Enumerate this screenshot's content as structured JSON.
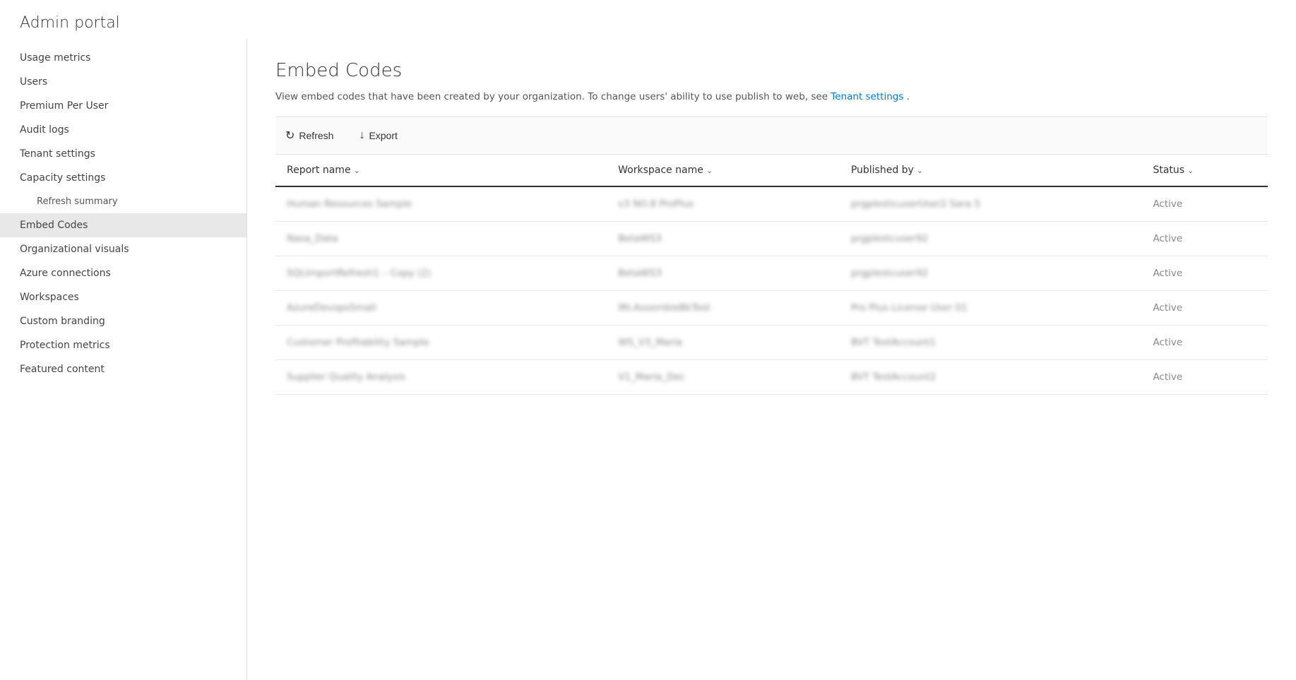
{
  "app": {
    "title": "Admin portal"
  },
  "sidebar": {
    "items": [
      {
        "id": "usage-metrics",
        "label": "Usage metrics",
        "indented": false,
        "active": false
      },
      {
        "id": "users",
        "label": "Users",
        "indented": false,
        "active": false
      },
      {
        "id": "premium-per-user",
        "label": "Premium Per User",
        "indented": false,
        "active": false
      },
      {
        "id": "audit-logs",
        "label": "Audit logs",
        "indented": false,
        "active": false
      },
      {
        "id": "tenant-settings",
        "label": "Tenant settings",
        "indented": false,
        "active": false
      },
      {
        "id": "capacity-settings",
        "label": "Capacity settings",
        "indented": false,
        "active": false
      },
      {
        "id": "refresh-summary",
        "label": "Refresh summary",
        "indented": true,
        "active": false
      },
      {
        "id": "embed-codes",
        "label": "Embed Codes",
        "indented": false,
        "active": true
      },
      {
        "id": "organizational-visuals",
        "label": "Organizational visuals",
        "indented": false,
        "active": false
      },
      {
        "id": "azure-connections",
        "label": "Azure connections",
        "indented": false,
        "active": false
      },
      {
        "id": "workspaces",
        "label": "Workspaces",
        "indented": false,
        "active": false
      },
      {
        "id": "custom-branding",
        "label": "Custom branding",
        "indented": false,
        "active": false
      },
      {
        "id": "protection-metrics",
        "label": "Protection metrics",
        "indented": false,
        "active": false
      },
      {
        "id": "featured-content",
        "label": "Featured content",
        "indented": false,
        "active": false
      }
    ]
  },
  "main": {
    "title": "Embed Codes",
    "description": "View embed codes that have been created by your organization. To change users' ability to use publish to web, see ",
    "description_link": "Tenant settings",
    "description_suffix": ".",
    "toolbar": {
      "refresh_label": "Refresh",
      "export_label": "Export"
    },
    "table": {
      "columns": [
        {
          "id": "report-name",
          "label": "Report name"
        },
        {
          "id": "workspace-name",
          "label": "Workspace name"
        },
        {
          "id": "published-by",
          "label": "Published by"
        },
        {
          "id": "status",
          "label": "Status"
        }
      ],
      "rows": [
        {
          "report_name": "Human Resources Sample",
          "workspace_name": "v3 NO.8 ProPlus",
          "published_by": "prgplesticuserUser2 Sara S",
          "status": "Active"
        },
        {
          "report_name": "Nasa_Data",
          "workspace_name": "BetaWS3",
          "published_by": "prgplestcuser92",
          "status": "Active"
        },
        {
          "report_name": "SQLImportRefresh1 – Copy (2)",
          "workspace_name": "BetaWS3",
          "published_by": "prgplestcuser92",
          "status": "Active"
        },
        {
          "report_name": "AzureDevopsSmall",
          "workspace_name": "IRI.AssembleBkTest",
          "published_by": "Pro Plus License User 01",
          "status": "Active"
        },
        {
          "report_name": "Customer Profitability Sample",
          "workspace_name": "WS_V3_Maria",
          "published_by": "BVT TestAccount1",
          "status": "Active"
        },
        {
          "report_name": "Supplier Quality Analysis",
          "workspace_name": "V1_Maria_Dec",
          "published_by": "BVT TestAccount2",
          "status": "Active"
        }
      ]
    }
  }
}
